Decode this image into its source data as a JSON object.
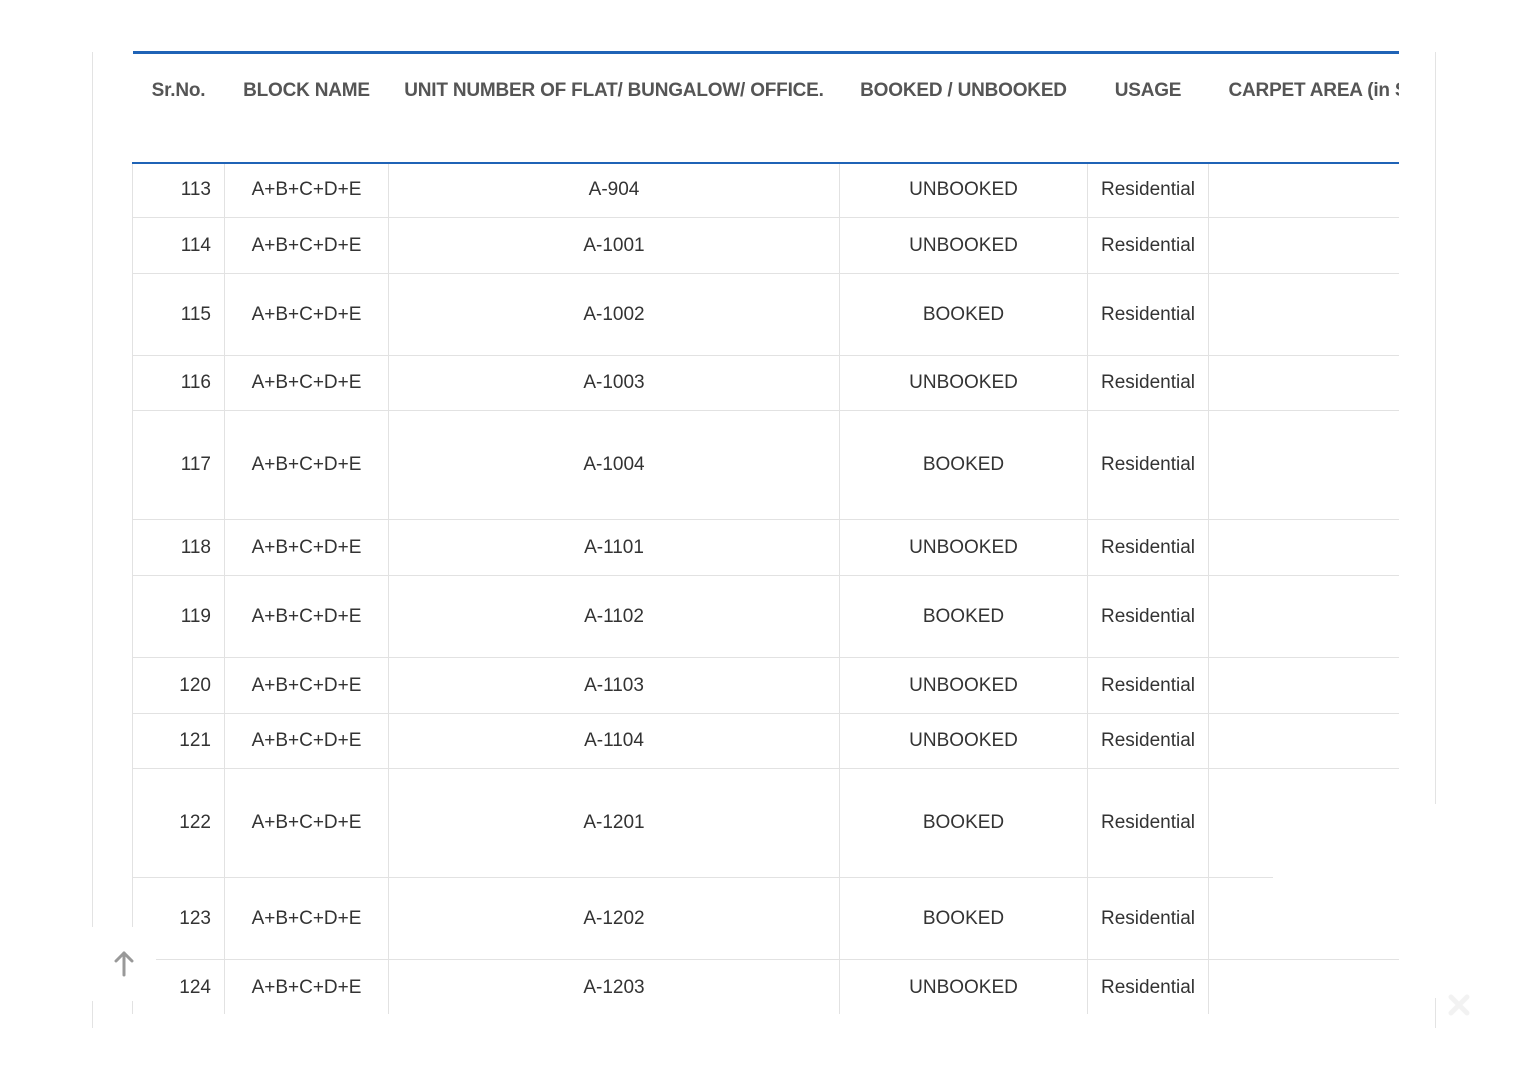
{
  "table": {
    "headers": {
      "sr_no": "Sr.No.",
      "block_name": "BLOCK NAME",
      "unit_number": "UNIT NUMBER OF FLAT/ BUNGALOW/ OFFICE.",
      "booked": "BOOKED / UNBOOKED",
      "usage": "USAGE",
      "carpet_area": "CARPET AREA (in Sq"
    },
    "rows": [
      {
        "sr": "113",
        "block": "A+B+C+D+E",
        "unit": "A-904",
        "status": "UNBOOKED",
        "usage": "Residential",
        "carpet": ""
      },
      {
        "sr": "114",
        "block": "A+B+C+D+E",
        "unit": "A-1001",
        "status": "UNBOOKED",
        "usage": "Residential",
        "carpet": ""
      },
      {
        "sr": "115",
        "block": "A+B+C+D+E",
        "unit": "A-1002",
        "status": "BOOKED",
        "usage": "Residential",
        "carpet": ""
      },
      {
        "sr": "116",
        "block": "A+B+C+D+E",
        "unit": "A-1003",
        "status": "UNBOOKED",
        "usage": "Residential",
        "carpet": ""
      },
      {
        "sr": "117",
        "block": "A+B+C+D+E",
        "unit": "A-1004",
        "status": "BOOKED",
        "usage": "Residential",
        "carpet": ""
      },
      {
        "sr": "118",
        "block": "A+B+C+D+E",
        "unit": "A-1101",
        "status": "UNBOOKED",
        "usage": "Residential",
        "carpet": ""
      },
      {
        "sr": "119",
        "block": "A+B+C+D+E",
        "unit": "A-1102",
        "status": "BOOKED",
        "usage": "Residential",
        "carpet": ""
      },
      {
        "sr": "120",
        "block": "A+B+C+D+E",
        "unit": "A-1103",
        "status": "UNBOOKED",
        "usage": "Residential",
        "carpet": ""
      },
      {
        "sr": "121",
        "block": "A+B+C+D+E",
        "unit": "A-1104",
        "status": "UNBOOKED",
        "usage": "Residential",
        "carpet": ""
      },
      {
        "sr": "122",
        "block": "A+B+C+D+E",
        "unit": "A-1201",
        "status": "BOOKED",
        "usage": "Residential",
        "carpet": ""
      },
      {
        "sr": "123",
        "block": "A+B+C+D+E",
        "unit": "A-1202",
        "status": "BOOKED",
        "usage": "Residential",
        "carpet": ""
      },
      {
        "sr": "124",
        "block": "A+B+C+D+E",
        "unit": "A-1203",
        "status": "UNBOOKED",
        "usage": "Residential",
        "carpet": ""
      }
    ]
  },
  "controls": {
    "scroll_top_icon": "arrow-up-icon",
    "close_icon": "close-icon"
  },
  "colors": {
    "header_rule": "#1f63b6",
    "grid": "#e2e2e2",
    "text": "#333333"
  }
}
